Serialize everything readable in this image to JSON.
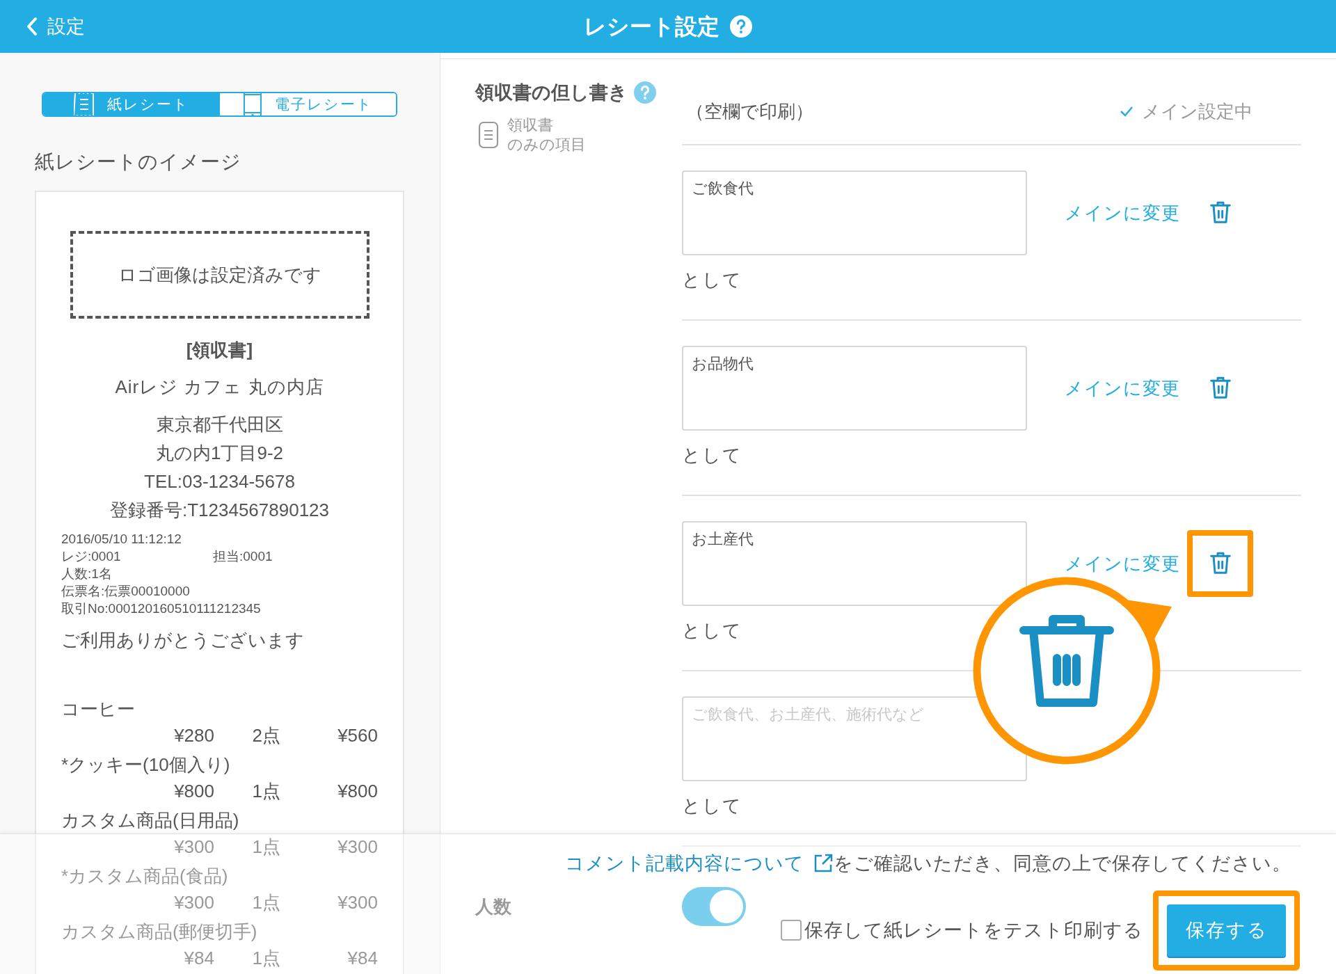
{
  "header": {
    "back_label": "設定",
    "title": "レシート設定"
  },
  "tabs": [
    {
      "kind": "paper",
      "label": "紙レシート",
      "selected": true
    },
    {
      "kind": "phone",
      "label": "電子レシート",
      "selected": false
    }
  ],
  "preview_title": "紙レシートのイメージ",
  "receipt": {
    "logo_note": "ロゴ画像は設定済みです",
    "heading": "[領収書]",
    "store": "Airレジ カフェ 丸の内店",
    "address": [
      "東京都千代田区",
      "丸の内1丁目9-2"
    ],
    "tel": "TEL:03-1234-5678",
    "registration": "登録番号:T1234567890123",
    "meta": [
      {
        "left": "2016/05/10 11:12:12"
      },
      {
        "left": "レジ:0001",
        "right": "担当:0001"
      },
      {
        "left": "人数:1名"
      },
      {
        "left": "伝票名:伝票00010000"
      },
      {
        "left": "取引No:000120160510111212345"
      }
    ],
    "thanks": "ご利用ありがとうございます",
    "items": [
      {
        "name": "コーヒー",
        "price": "¥280",
        "qty": "2点",
        "total": "¥560"
      },
      {
        "name": "*クッキー(10個入り)",
        "price": "¥800",
        "qty": "1点",
        "total": "¥800"
      },
      {
        "name": "カスタム商品(日用品)",
        "price": "¥300",
        "qty": "1点",
        "total": "¥300"
      },
      {
        "name": "*カスタム商品(食品)",
        "price": "¥300",
        "qty": "1点",
        "total": "¥300"
      },
      {
        "name": "カスタム商品(郵便切手)",
        "price": "¥84",
        "qty": "1点",
        "total": "¥84"
      }
    ]
  },
  "note_section": {
    "title": "領収書の但し書き",
    "subtitle": [
      "領収書",
      "のみの項目"
    ],
    "default_row": {
      "label": "（空欄で印刷）",
      "status": "メイン設定中"
    },
    "rows": [
      {
        "value": "ご飲食代",
        "suffix": "として",
        "action": "メインに変更",
        "highlighted": false
      },
      {
        "value": "お品物代",
        "suffix": "として",
        "action": "メインに変更",
        "highlighted": false
      },
      {
        "value": "お土産代",
        "suffix": "として",
        "action": "メインに変更",
        "highlighted": true
      },
      {
        "placeholder": "ご飲食代、お土産代、施術代など",
        "suffix": "として"
      }
    ]
  },
  "people": {
    "label": "人数",
    "on": true
  },
  "footer": {
    "notice_link": "コメント記載内容について",
    "notice_text": "をご確認いただき、同意の上で保存してください。",
    "test_print": {
      "label": "保存して紙レシートをテスト印刷する",
      "checked": false
    },
    "save_button": {
      "label": "保存する",
      "highlighted": true
    }
  }
}
